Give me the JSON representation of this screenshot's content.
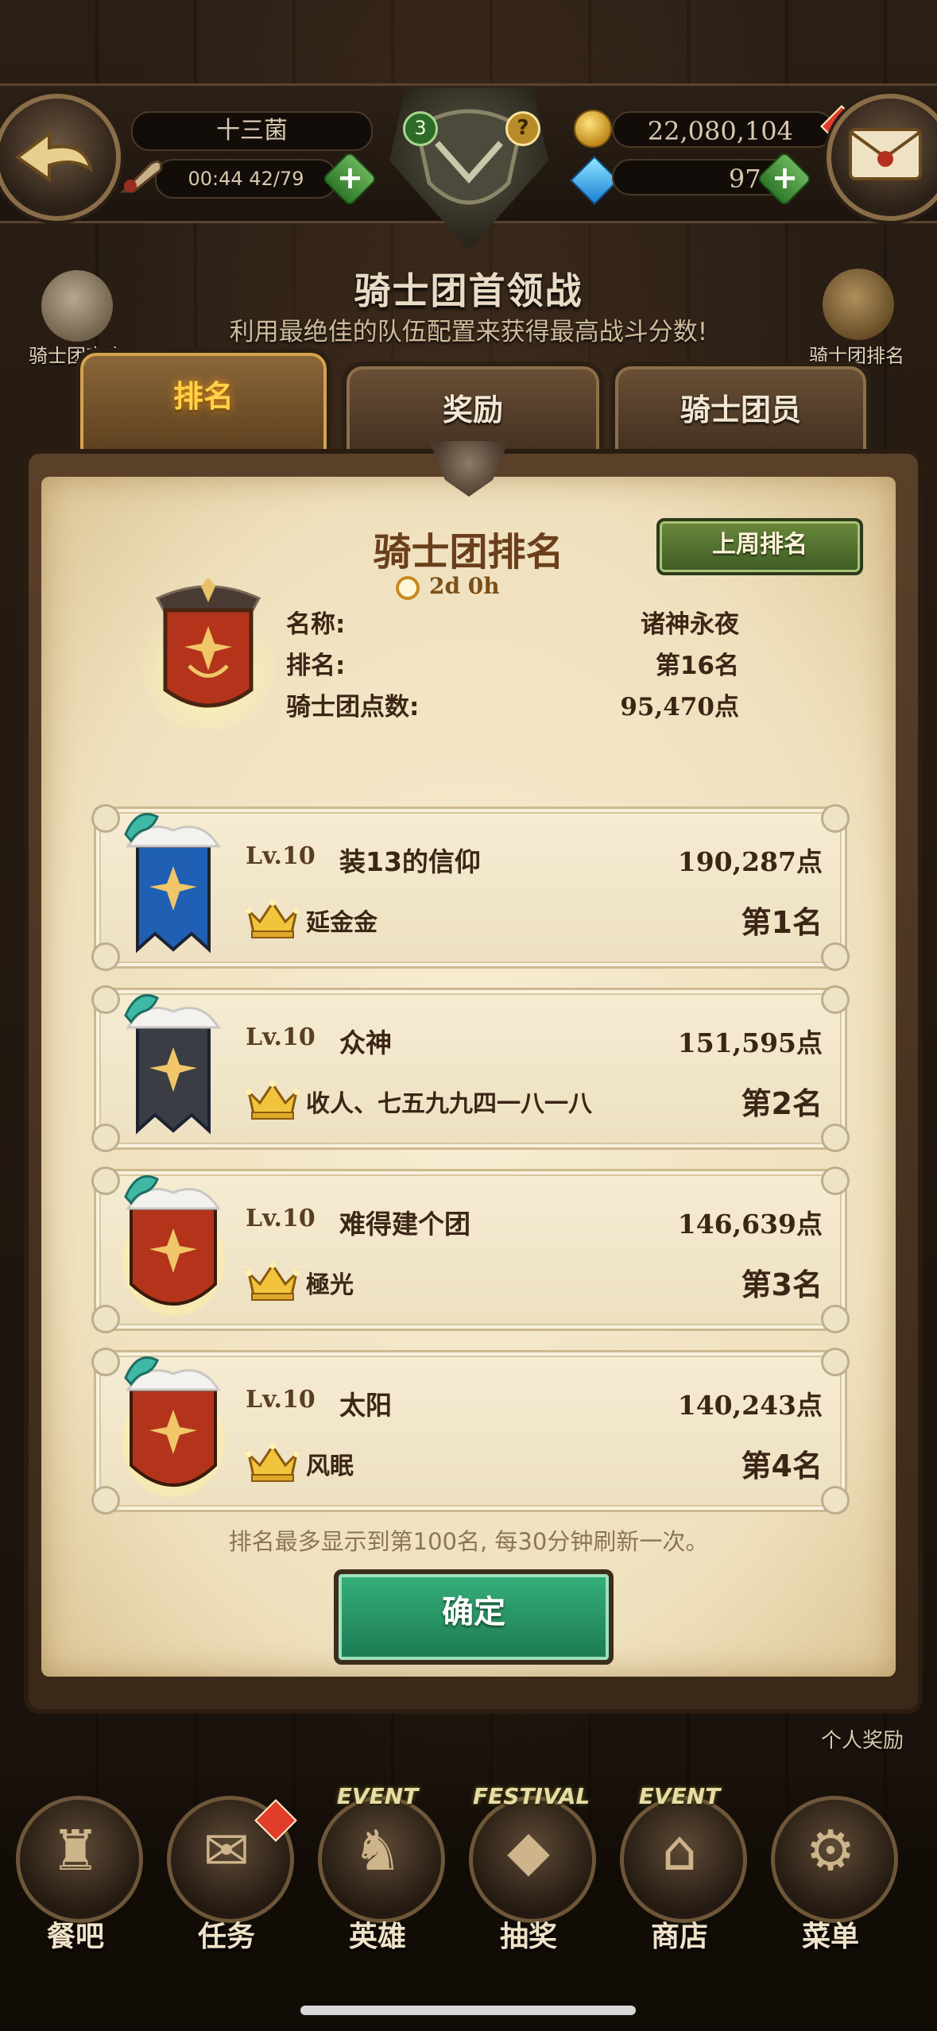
{
  "header": {
    "player_name": "十三菌",
    "stamina": "00:44 42/79",
    "gold": "22,080,104",
    "gems": "976",
    "level_badge": "3",
    "help_badge": "?",
    "title": "骑士团首领战",
    "subtitle": "利用最绝佳的队伍配置来获得最高战斗分数!",
    "left_shortcut": "骑士团商店",
    "right_shortcut": "骑士团排名"
  },
  "tabs": [
    {
      "label": "排名",
      "active": true
    },
    {
      "label": "奖励",
      "active": false
    },
    {
      "label": "骑士团员",
      "active": false
    }
  ],
  "panel": {
    "title": "骑士团排名",
    "timer": "2d 0h",
    "last_week_button": "上周排名",
    "my_guild": {
      "name_label": "名称:",
      "name_value": "诸神永夜",
      "rank_label": "排名:",
      "rank_value": "第16名",
      "points_label": "骑士团点数:",
      "points_value": "95,470点"
    },
    "rankings": [
      {
        "level": "Lv.10",
        "name": "装13的信仰",
        "points": "190,287点",
        "leader": "延金金",
        "rank": "第1名",
        "banner_color": "#1f5fb4"
      },
      {
        "level": "Lv.10",
        "name": "众神",
        "points": "151,595点",
        "leader": "收人、七五九九四一八一八",
        "rank": "第2名",
        "banner_color": "#3a3d44"
      },
      {
        "level": "Lv.10",
        "name": "难得建个团",
        "points": "146,639点",
        "leader": "極光",
        "rank": "第3名",
        "banner_color": "#b3341a"
      },
      {
        "level": "Lv.10",
        "name": "太阳",
        "points": "140,243点",
        "leader": "风眠",
        "rank": "第4名",
        "banner_color": "#b3341a"
      }
    ],
    "footnote": "排名最多显示到第100名, 每30分钟刷新一次。",
    "confirm_button": "确定"
  },
  "personal_reward": "个人奖励",
  "bottom_nav": [
    {
      "label": "餐吧",
      "icon": "tavern-icon",
      "tag": ""
    },
    {
      "label": "任务",
      "icon": "quest-scroll-icon",
      "tag": ""
    },
    {
      "label": "英雄",
      "icon": "hero-helmet-icon",
      "tag": "EVENT"
    },
    {
      "label": "抽奖",
      "icon": "crystal-icon",
      "tag": "FESTIVAL"
    },
    {
      "label": "商店",
      "icon": "shop-icon",
      "tag": "EVENT"
    },
    {
      "label": "菜单",
      "icon": "gear-icon",
      "tag": ""
    }
  ],
  "colors": {
    "parchment": "#efe0bd",
    "accent_gold": "#ffd24a",
    "confirm_green": "#2a9a68"
  }
}
